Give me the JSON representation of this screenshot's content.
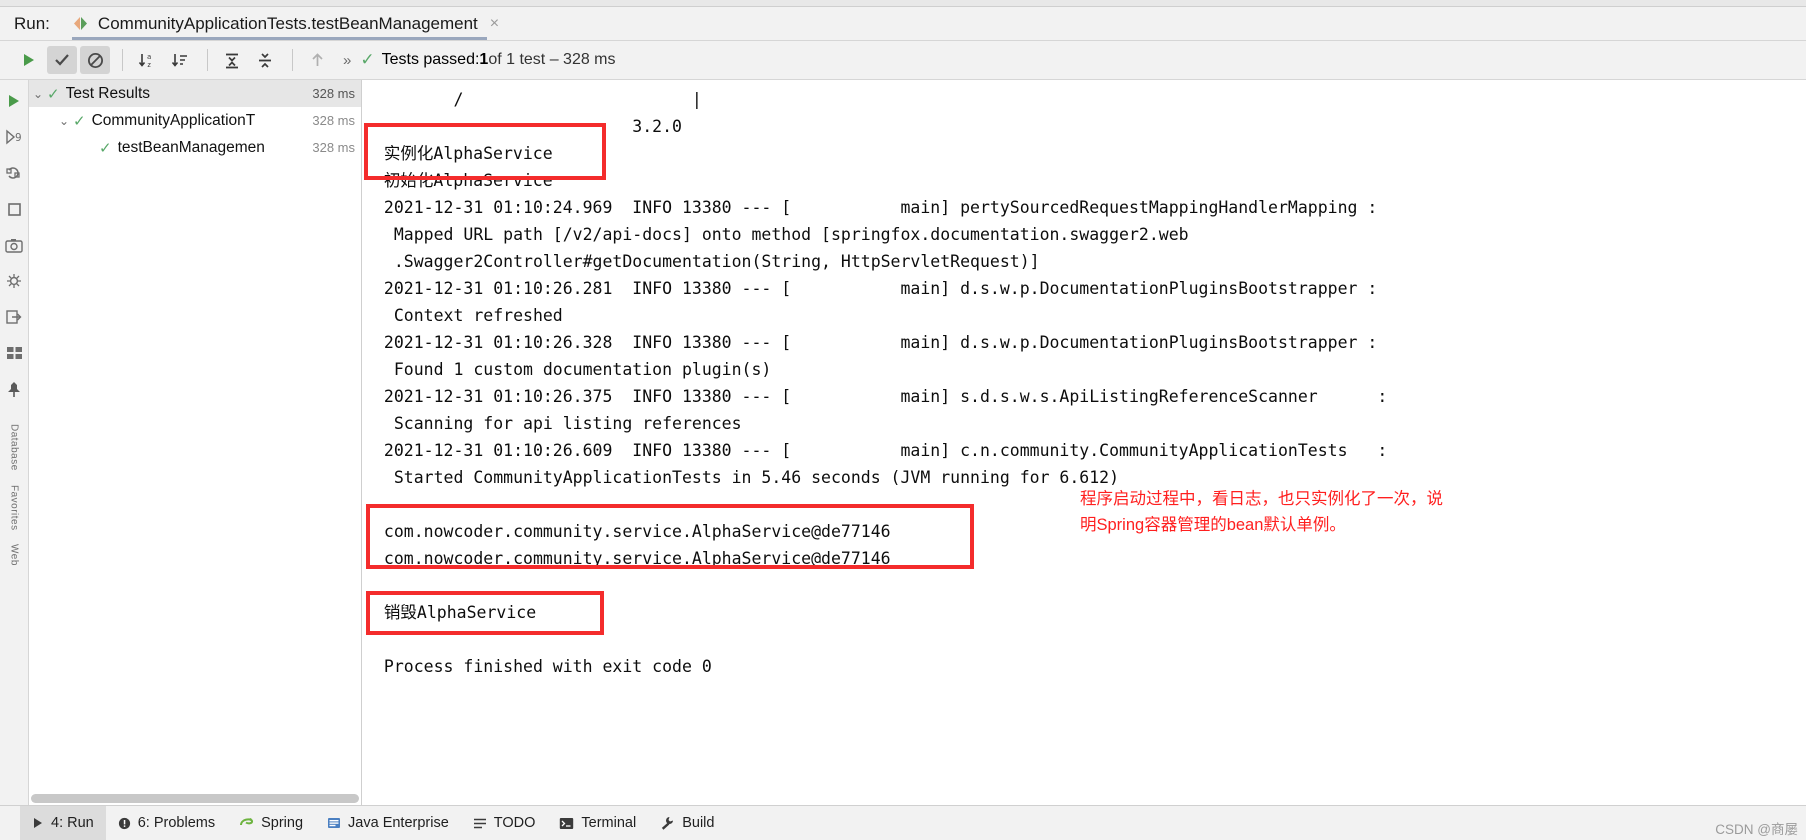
{
  "window": {
    "run_label": "Run:",
    "tab_title": "CommunityApplicationTests.testBeanManagement",
    "tab_close": "×"
  },
  "toolbar": {
    "rerun_icon": "play-icon",
    "toggle_passed_icon": "check-icon",
    "toggle_ignored_icon": "block-icon",
    "sort_alpha_icon": "sort-alphabetically-icon",
    "sort_duration_icon": "sort-by-duration-icon",
    "expand_all_icon": "expand-all-icon",
    "collapse_all_icon": "collapse-all-icon",
    "prev_icon": "up-arrow-icon",
    "overflow_icon": "chevron-right-right-icon",
    "status_check_icon": "check-icon",
    "status_prefix": "Tests passed: ",
    "status_count": "1",
    "status_suffix": " of 1 test – 328 ms"
  },
  "gutter": {
    "icons": [
      "run-icon",
      "debug-step-icon",
      "rerun-icon",
      "stop-icon",
      "screenshot-icon",
      "thread-dump-icon",
      "export-icon",
      "layout-icon",
      "pin-icon"
    ],
    "vertical_labels": [
      "Database",
      "Favorites",
      "Web"
    ]
  },
  "tree": {
    "rows": [
      {
        "indent": 0,
        "arrow": "∨",
        "check": "✔",
        "label": "Test Results",
        "ms": "328 ms",
        "selected": true
      },
      {
        "indent": 1,
        "arrow": "∨",
        "check": "✔",
        "label": "CommunityApplicationT",
        "ms": "328 ms",
        "selected": false
      },
      {
        "indent": 2,
        "arrow": "",
        "check": "✔",
        "label": "testBeanManagemen",
        "ms": "328 ms",
        "selected": false
      }
    ]
  },
  "console": {
    "lines": [
      "        /                       |",
      "                          3.2.0",
      " 实例化AlphaService",
      " 初始化AlphaService",
      " 2021-12-31 01:10:24.969  INFO 13380 --- [           main] pertySourcedRequestMappingHandlerMapping :",
      "  Mapped URL path [/v2/api-docs] onto method [springfox.documentation.swagger2.web",
      "  .Swagger2Controller#getDocumentation(String, HttpServletRequest)]",
      " 2021-12-31 01:10:26.281  INFO 13380 --- [           main] d.s.w.p.DocumentationPluginsBootstrapper :",
      "  Context refreshed",
      " 2021-12-31 01:10:26.328  INFO 13380 --- [           main] d.s.w.p.DocumentationPluginsBootstrapper :",
      "  Found 1 custom documentation plugin(s)",
      " 2021-12-31 01:10:26.375  INFO 13380 --- [           main] s.d.s.w.s.ApiListingReferenceScanner      :",
      "  Scanning for api listing references",
      " 2021-12-31 01:10:26.609  INFO 13380 --- [           main] c.n.community.CommunityApplicationTests   :",
      "  Started CommunityApplicationTests in 5.46 seconds (JVM running for 6.612)",
      "",
      " com.nowcoder.community.service.AlphaService@de77146",
      " com.nowcoder.community.service.AlphaService@de77146",
      "",
      " 销毁AlphaService",
      "",
      " Process finished with exit code 0"
    ]
  },
  "annotations": {
    "note_right": "程序启动过程中，看日志，也只实例化了一次，说\n明Spring容器管理的bean默认单例。",
    "highlight_color": "#f42c2c",
    "note_color": "#ff1f1f"
  },
  "statusbar": {
    "items": [
      {
        "icon": "play-icon",
        "label": "4: Run",
        "underline": "4",
        "active": true
      },
      {
        "icon": "problems-icon",
        "label": "6: Problems",
        "underline": "6",
        "active": false
      },
      {
        "icon": "spring-icon",
        "label": "Spring",
        "underline": "",
        "active": false
      },
      {
        "icon": "java-enterprise-icon",
        "label": "Java Enterprise",
        "underline": "",
        "active": false
      },
      {
        "icon": "todo-icon",
        "label": "TODO",
        "underline": "",
        "active": false
      },
      {
        "icon": "terminal-icon",
        "label": "Terminal",
        "underline": "",
        "active": false
      },
      {
        "icon": "build-icon",
        "label": "Build",
        "underline": "",
        "active": false
      }
    ],
    "watermark": "CSDN @商屡"
  }
}
